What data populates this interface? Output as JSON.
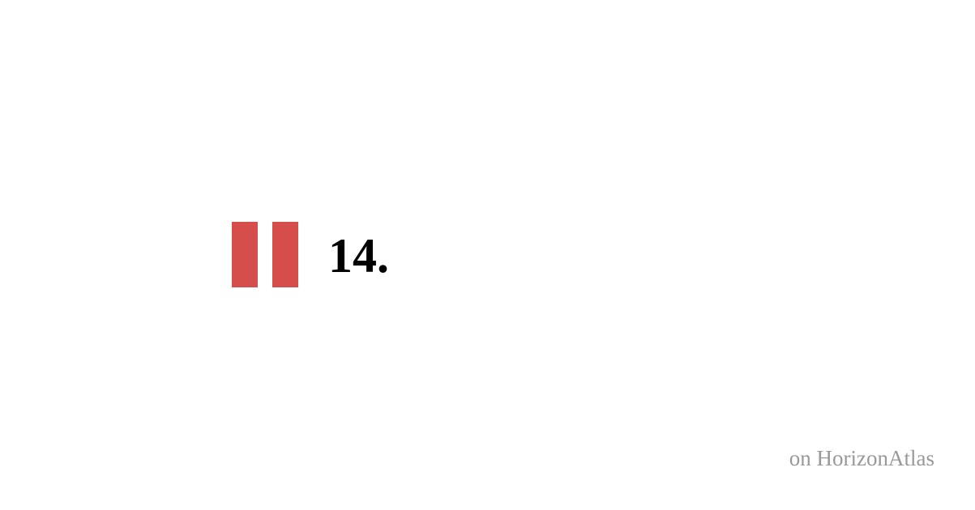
{
  "item": {
    "number": "14.",
    "icon": "pause-icon"
  },
  "footer": {
    "source_text": "on HorizonAtlas"
  },
  "colors": {
    "accent": "#d64e4b",
    "text": "#000000",
    "muted": "#999999",
    "background": "#ffffff"
  }
}
